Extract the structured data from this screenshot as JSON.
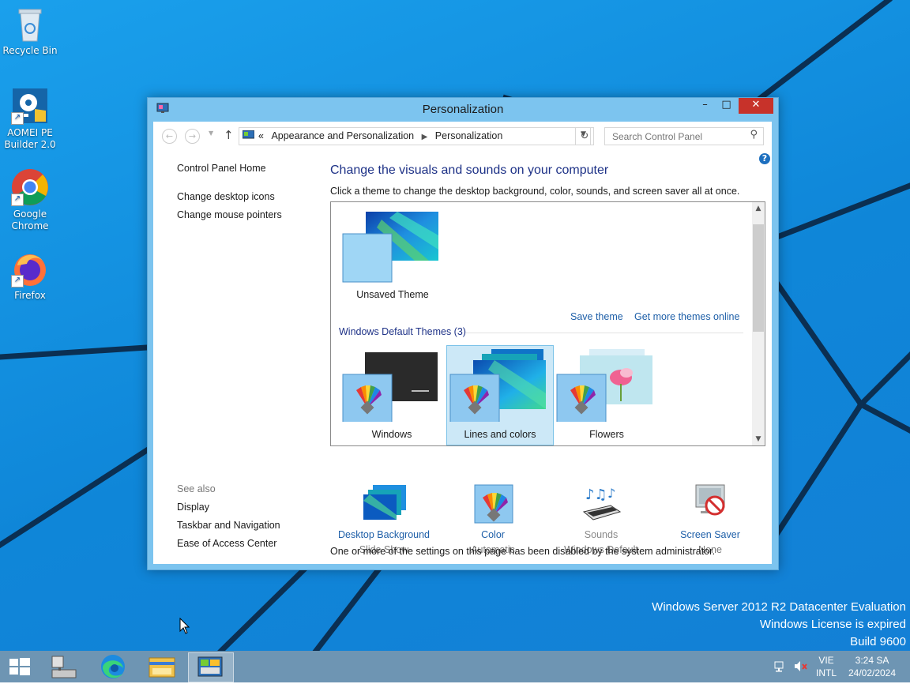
{
  "desktop": {
    "icons": [
      {
        "label": "Recycle Bin",
        "icon": "recycle-bin-icon"
      },
      {
        "label": "AOMEI PE Builder 2.0",
        "icon": "aomei-icon"
      },
      {
        "label": "Google Chrome",
        "icon": "chrome-icon"
      },
      {
        "label": "Firefox",
        "icon": "firefox-icon"
      }
    ],
    "watermark": [
      "Windows Server 2012 R2 Datacenter Evaluation",
      "Windows License is expired",
      "Build 9600"
    ]
  },
  "window": {
    "title": "Personalization",
    "controls": {
      "minimize": "–",
      "maximize": "□",
      "close": "✕"
    },
    "address": {
      "overflow": "«",
      "crumbs": [
        "Appearance and Personalization",
        "Personalization"
      ]
    },
    "search": {
      "placeholder": "Search Control Panel"
    },
    "help": "?"
  },
  "sidebar": {
    "home": "Control Panel Home",
    "links": [
      "Change desktop icons",
      "Change mouse pointers"
    ],
    "see_also_label": "See also",
    "see_also": [
      "Display",
      "Taskbar and Navigation",
      "Ease of Access Center"
    ]
  },
  "main": {
    "heading": "Change the visuals and sounds on your computer",
    "subtext": "Click a theme to change the desktop background, color, sounds, and screen saver all at once.",
    "my_theme": {
      "label": "Unsaved Theme"
    },
    "save_theme": "Save theme",
    "get_more": "Get more themes online",
    "group": "Windows Default Themes (3)",
    "themes": [
      {
        "label": "Windows",
        "selected": false
      },
      {
        "label": "Lines and colors",
        "selected": true
      },
      {
        "label": "Flowers",
        "selected": false
      }
    ],
    "settings": [
      {
        "title": "Desktop Background",
        "value": "Slide Show",
        "enabled": true
      },
      {
        "title": "Color",
        "value": "Automatic",
        "enabled": true
      },
      {
        "title": "Sounds",
        "value": "Windows Default",
        "enabled": false
      },
      {
        "title": "Screen Saver",
        "value": "None",
        "enabled": true
      }
    ],
    "notice": "One or more of the settings on this page has been disabled by the system administrator."
  },
  "taskbar": {
    "items": [
      "start-icon",
      "server-manager-icon",
      "edge-icon",
      "file-explorer-icon",
      "control-panel-icon"
    ],
    "lang": [
      "VIE",
      "INTL"
    ],
    "time": "3:24 SA",
    "date": "24/02/2024"
  }
}
